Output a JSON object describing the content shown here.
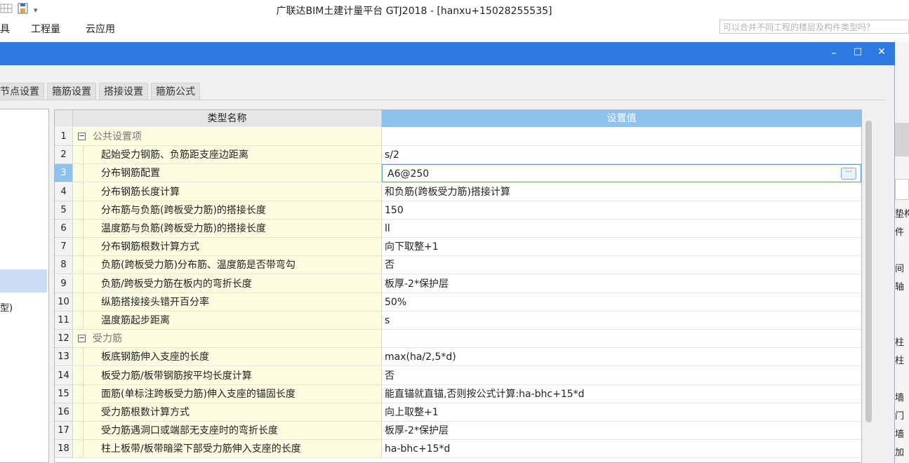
{
  "app": {
    "title": "广联达BIM土建计量平台 GTJ2018 - [hanxu+15028255535]",
    "qat_icon_1": "grid-icon",
    "qat_icon_2": "save-icon",
    "qat_caret": "▾"
  },
  "menu": {
    "items": [
      "具",
      "工程量",
      "云应用"
    ],
    "search_placeholder": "可以合并不同工程的楼层及构件类型吗？"
  },
  "dialog": {
    "window_buttons": {
      "minimize": "–",
      "maximize": "□",
      "close": "✕"
    },
    "tabs": [
      "节点设置",
      "箍筋设置",
      "搭接设置",
      "箍筋公式"
    ]
  },
  "left_panel": {
    "partial_text": "型)"
  },
  "right_strip": {
    "texts": [
      "垫构",
      "件",
      "间",
      "轴",
      "柱",
      "柱",
      "墙",
      "门",
      "墙",
      "加"
    ]
  },
  "table": {
    "headers": {
      "name": "类型名称",
      "value": "设置值"
    },
    "selected_row": 3,
    "rows": [
      {
        "num": "1",
        "name": "公共设置项",
        "value": "",
        "group": true
      },
      {
        "num": "2",
        "name": "起始受力钢筋、负筋距支座边距离",
        "value": "s/2",
        "group": false
      },
      {
        "num": "3",
        "name": "分布钢筋配置",
        "value": "A6@250",
        "group": false
      },
      {
        "num": "4",
        "name": "分布钢筋长度计算",
        "value": "和负筋(跨板受力筋)搭接计算",
        "group": false
      },
      {
        "num": "5",
        "name": "分布筋与负筋(跨板受力筋)的搭接长度",
        "value": "150",
        "group": false
      },
      {
        "num": "6",
        "name": "温度筋与负筋(跨板受力筋)的搭接长度",
        "value": "ll",
        "group": false
      },
      {
        "num": "7",
        "name": "分布钢筋根数计算方式",
        "value": "向下取整+1",
        "group": false
      },
      {
        "num": "8",
        "name": "负筋(跨板受力筋)分布筋、温度筋是否带弯勾",
        "value": "否",
        "group": false
      },
      {
        "num": "9",
        "name": "负筋/跨板受力筋在板内的弯折长度",
        "value": "板厚-2*保护层",
        "group": false
      },
      {
        "num": "10",
        "name": "纵筋搭接接头错开百分率",
        "value": "50%",
        "group": false
      },
      {
        "num": "11",
        "name": "温度筋起步距离",
        "value": "s",
        "group": false
      },
      {
        "num": "12",
        "name": "受力筋",
        "value": "",
        "group": true
      },
      {
        "num": "13",
        "name": "板底钢筋伸入支座的长度",
        "value": "max(ha/2,5*d)",
        "group": false
      },
      {
        "num": "14",
        "name": "板受力筋/板带钢筋按平均长度计算",
        "value": "否",
        "group": false
      },
      {
        "num": "15",
        "name": "面筋(单标注跨板受力筋)伸入支座的锚固长度",
        "value": "能直锚就直锚,否则按公式计算:ha-bhc+15*d",
        "group": false
      },
      {
        "num": "16",
        "name": "受力筋根数计算方式",
        "value": "向上取整+1",
        "group": false
      },
      {
        "num": "17",
        "name": "受力筋遇洞口或端部无支座时的弯折长度",
        "value": "板厚-2*保护层",
        "group": false
      },
      {
        "num": "18",
        "name": "柱上板带/板带暗梁下部受力筋伸入支座的长度",
        "value": "ha-bhc+15*d",
        "group": false
      }
    ]
  }
}
